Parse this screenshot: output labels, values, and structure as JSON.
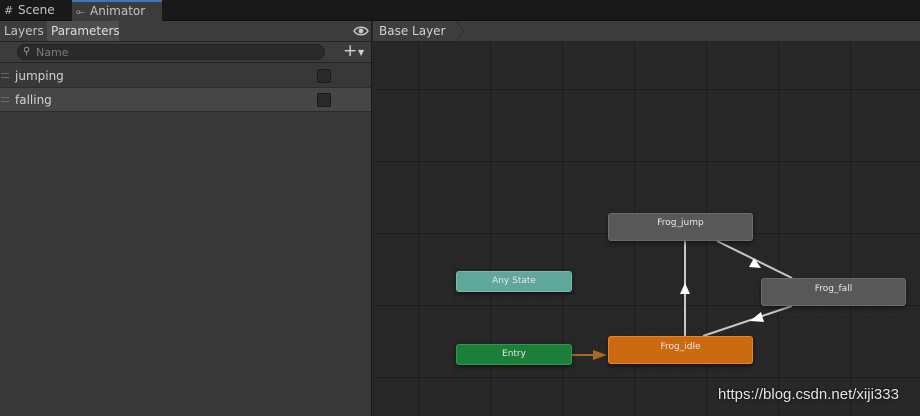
{
  "window_tabs": [
    {
      "label": "Scene",
      "icon": "grid-icon"
    },
    {
      "label": "Animator",
      "icon": "animator-icon"
    }
  ],
  "left_panel": {
    "tabs": [
      "Layers",
      "Parameters"
    ],
    "active_tab": "Parameters",
    "search_placeholder": "Name",
    "parameters": [
      {
        "name": "jumping",
        "type": "bool",
        "checked": false
      },
      {
        "name": "falling",
        "type": "bool",
        "checked": false
      }
    ]
  },
  "graph": {
    "breadcrumb": "Base Layer",
    "states": [
      {
        "id": "jump",
        "label": "Frog_jump",
        "color": "#585858"
      },
      {
        "id": "fall",
        "label": "Frog_fall",
        "color": "#585858"
      },
      {
        "id": "idle",
        "label": "Frog_idle",
        "color": "#cc6a12"
      },
      {
        "id": "any",
        "label": "Any State",
        "color": "#5ea79a"
      },
      {
        "id": "entry",
        "label": "Entry",
        "color": "#1c7f39"
      }
    ]
  },
  "watermark": "https://blog.csdn.net/xiji333",
  "colors": {
    "accent": "#3a79bb",
    "default_state_arrow": "#a86a1a"
  }
}
